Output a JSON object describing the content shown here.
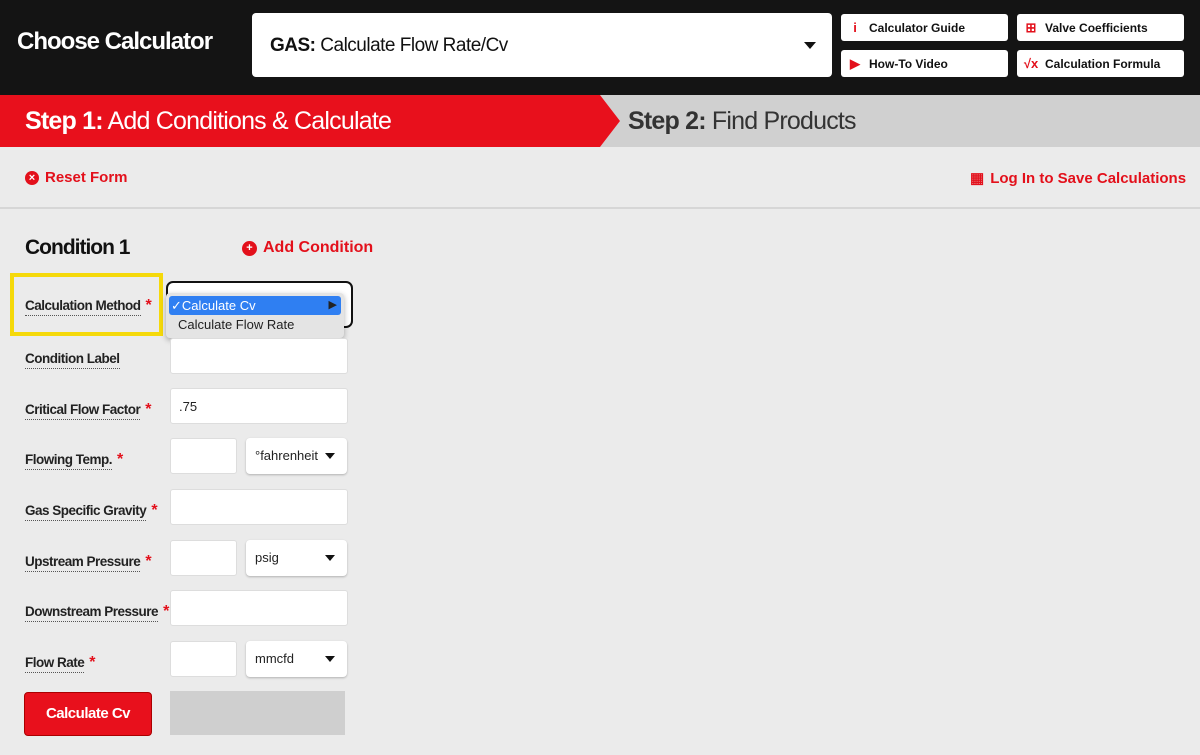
{
  "header": {
    "title": "Choose Calculator",
    "calculator_select": {
      "prefix": "GAS:",
      "value": "Calculate Flow Rate/Cv"
    },
    "buttons": [
      {
        "label": "Calculator Guide",
        "icon": "info-icon"
      },
      {
        "label": "Valve Coefficients",
        "icon": "table-icon"
      },
      {
        "label": "How-To Video",
        "icon": "play-icon"
      },
      {
        "label": "Calculation Formula",
        "icon": "sqrt-icon"
      }
    ]
  },
  "steps": [
    {
      "prefix": "Step 1:",
      "label": "Add Conditions & Calculate",
      "active": true
    },
    {
      "prefix": "Step 2:",
      "label": "Find Products",
      "active": false
    }
  ],
  "toolbar": {
    "reset": "Reset Form",
    "login": "Log In to Save Calculations"
  },
  "condition": {
    "title": "Condition 1",
    "add": "Add Condition",
    "method": {
      "label": "Calculation Method",
      "options": [
        "Calculate Cv",
        "Calculate Flow Rate"
      ],
      "selected": "Calculate Cv"
    },
    "fields": [
      {
        "label": "Condition Label",
        "required": false,
        "value": ""
      },
      {
        "label": "Critical Flow Factor",
        "required": true,
        "value": ".75"
      },
      {
        "label": "Flowing Temp.",
        "required": true,
        "value": "",
        "unit": "°fahrenheit"
      },
      {
        "label": "Gas Specific Gravity",
        "required": true,
        "value": ""
      },
      {
        "label": "Upstream Pressure",
        "required": true,
        "value": "",
        "unit": "psig"
      },
      {
        "label": "Downstream Pressure",
        "required": true,
        "value": ""
      },
      {
        "label": "Flow Rate",
        "required": true,
        "value": "",
        "unit": "mmcfd"
      }
    ],
    "required_mark": "*",
    "calculate": "Calculate Cv"
  },
  "colors": {
    "brand_red": "#e8101c",
    "highlight": "#f5d90a",
    "selection_blue": "#2f7ff2"
  }
}
